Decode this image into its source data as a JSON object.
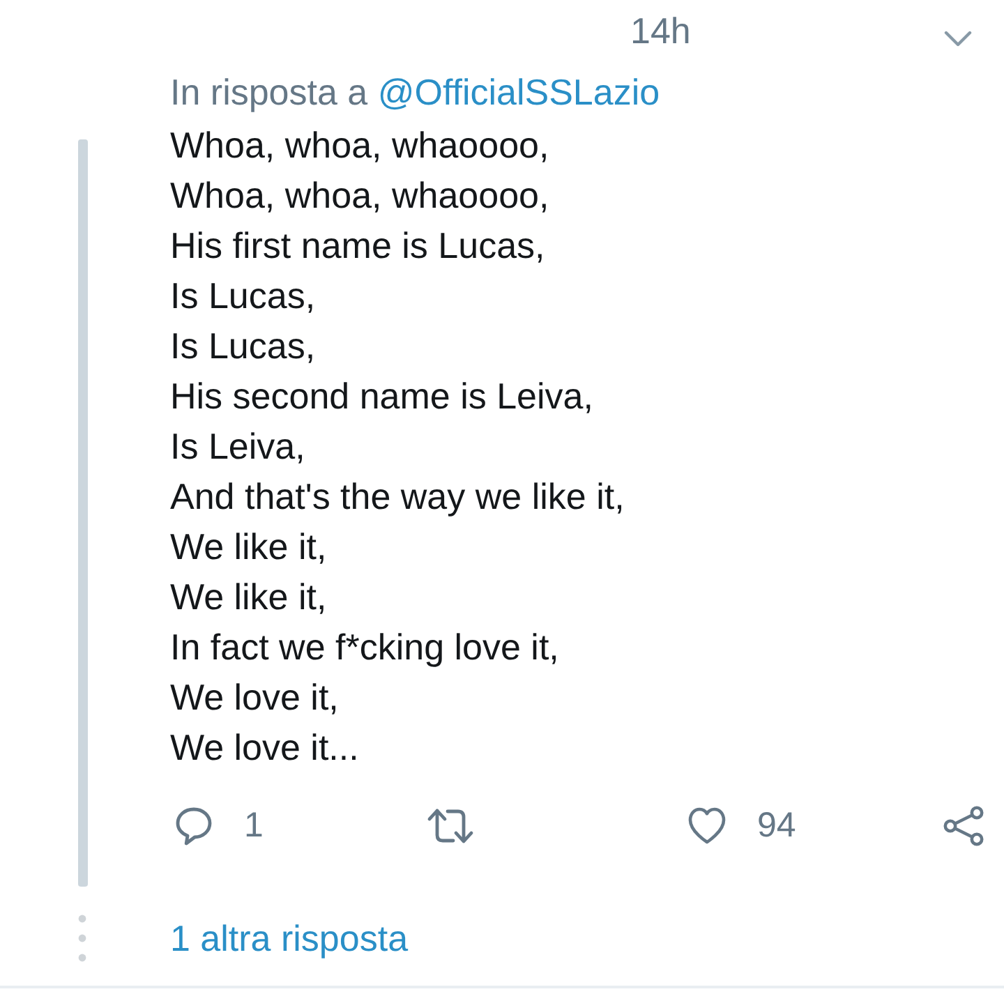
{
  "header": {
    "time": "14h"
  },
  "reply_context": {
    "text": "In risposta a",
    "mention": "@OfficialSSLazio"
  },
  "tweet_lines": [
    "Whoa, whoa, whaoooo,",
    "Whoa, whoa, whaoooo,",
    "His first name is Lucas,",
    "Is Lucas,",
    "Is Lucas,",
    "His second name is Leiva,",
    "Is Leiva,",
    "And that's the way we like it,",
    "We like it,",
    "We like it,",
    "In fact we f*cking love it,",
    "We love it,",
    "We love it..."
  ],
  "actions": [
    {
      "kind": "reply",
      "count": "1"
    },
    {
      "kind": "retweet"
    },
    {
      "kind": "like",
      "count": "94"
    },
    {
      "kind": "share"
    }
  ],
  "more_replies": "1 altra risposta"
}
